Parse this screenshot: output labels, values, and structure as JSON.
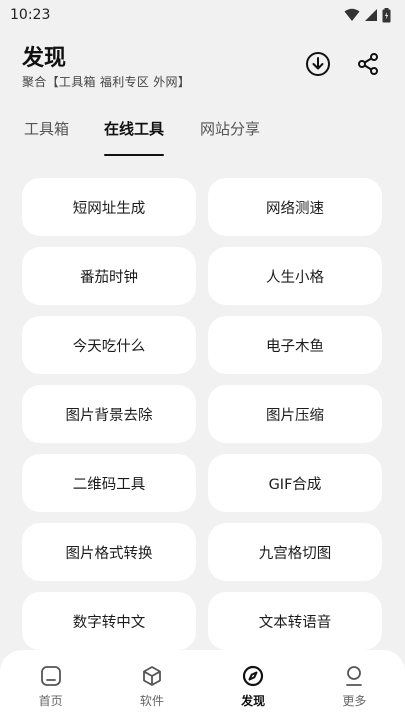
{
  "status_bar": {
    "time": "10:23"
  },
  "header": {
    "title": "发现",
    "subtitle": "聚合【工具箱 福利专区 外网】"
  },
  "tabs": [
    {
      "label": "工具箱",
      "active": false
    },
    {
      "label": "在线工具",
      "active": true
    },
    {
      "label": "网站分享",
      "active": false
    }
  ],
  "tools": [
    "短网址生成",
    "网络测速",
    "番茄时钟",
    "人生小格",
    "今天吃什么",
    "电子木鱼",
    "图片背景去除",
    "图片压缩",
    "二维码工具",
    "GIF合成",
    "图片格式转换",
    "九宫格切图",
    "数字转中文",
    "文本转语音"
  ],
  "bottom_nav": [
    {
      "label": "首页",
      "icon": "home-icon",
      "active": false
    },
    {
      "label": "软件",
      "icon": "cube-icon",
      "active": false
    },
    {
      "label": "发现",
      "icon": "compass-icon",
      "active": true
    },
    {
      "label": "更多",
      "icon": "user-icon",
      "active": false
    }
  ]
}
